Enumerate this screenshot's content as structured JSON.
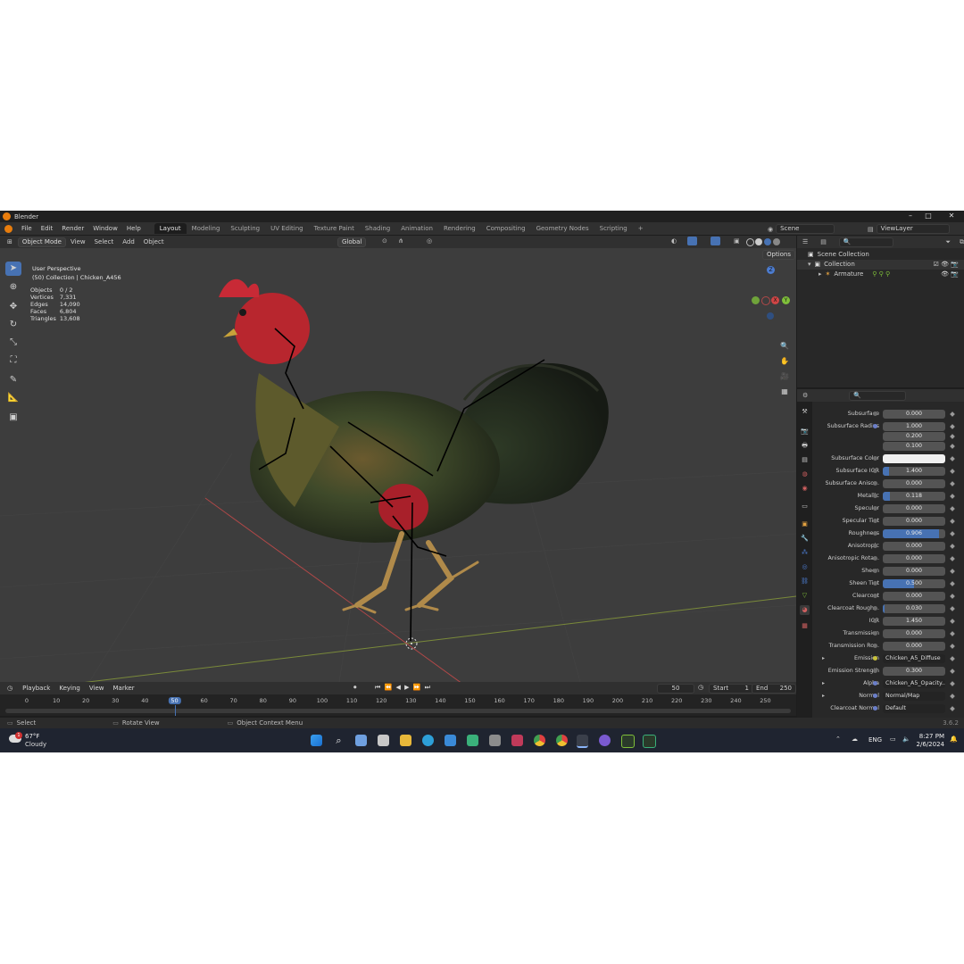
{
  "window": {
    "title": "Blender",
    "min": "–",
    "max": "□",
    "close": "✕"
  },
  "menu": [
    "File",
    "Edit",
    "Render",
    "Window",
    "Help"
  ],
  "workspaces": [
    {
      "label": "Layout",
      "active": true
    },
    {
      "label": "Modeling"
    },
    {
      "label": "Sculpting"
    },
    {
      "label": "UV Editing"
    },
    {
      "label": "Texture Paint"
    },
    {
      "label": "Shading"
    },
    {
      "label": "Animation"
    },
    {
      "label": "Rendering"
    },
    {
      "label": "Compositing"
    },
    {
      "label": "Geometry Nodes"
    },
    {
      "label": "Scripting"
    }
  ],
  "add_workspace": "+",
  "scene": "Scene",
  "view_layer": "ViewLayer",
  "viewport_header": {
    "mode": "Object Mode",
    "menus": [
      "View",
      "Select",
      "Add",
      "Object"
    ],
    "orientation": "Global",
    "options": "Options"
  },
  "overlay": {
    "perspective": "User Perspective",
    "collection": "(50) Collection | Chicken_A456",
    "stats": [
      {
        "label": "Objects",
        "value": "0 / 2"
      },
      {
        "label": "Vertices",
        "value": "7,331"
      },
      {
        "label": "Edges",
        "value": "14,090"
      },
      {
        "label": "Faces",
        "value": "6,804"
      },
      {
        "label": "Triangles",
        "value": "13,608"
      }
    ]
  },
  "gizmo": {
    "z": "Z",
    "y": "Y",
    "x": "X"
  },
  "outliner": {
    "root": "Scene Collection",
    "collection": "Collection",
    "item": "Armature"
  },
  "properties": [
    {
      "label": "Subsurface",
      "value": "0.000",
      "type": "num",
      "fill": 0
    },
    {
      "label": "Subsurface Radius",
      "value": "1.000",
      "type": "num",
      "fill": 0,
      "link": true
    },
    {
      "label": "",
      "value": "0.200",
      "type": "num",
      "fill": 0
    },
    {
      "label": "",
      "value": "0.100",
      "type": "num",
      "fill": 0
    },
    {
      "label": "Subsurface Color",
      "value": "",
      "type": "color",
      "color": "#f0f0f0"
    },
    {
      "label": "Subsurface IOR",
      "value": "1.400",
      "type": "num",
      "fill": 0.1
    },
    {
      "label": "Subsurface Aniso...",
      "value": "0.000",
      "type": "num",
      "fill": 0
    },
    {
      "label": "Metallic",
      "value": "0.118",
      "type": "num",
      "fill": 0.118
    },
    {
      "label": "Specular",
      "value": "0.000",
      "type": "num",
      "fill": 0
    },
    {
      "label": "Specular Tint",
      "value": "0.000",
      "type": "num",
      "fill": 0
    },
    {
      "label": "Roughness",
      "value": "0.906",
      "type": "num",
      "fill": 0.906
    },
    {
      "label": "Anisotropic",
      "value": "0.000",
      "type": "num",
      "fill": 0
    },
    {
      "label": "Anisotropic Rota...",
      "value": "0.000",
      "type": "num",
      "fill": 0
    },
    {
      "label": "Sheen",
      "value": "0.000",
      "type": "num",
      "fill": 0
    },
    {
      "label": "Sheen Tint",
      "value": "0.500",
      "type": "num",
      "fill": 0.5
    },
    {
      "label": "Clearcoat",
      "value": "0.000",
      "type": "num",
      "fill": 0
    },
    {
      "label": "Clearcoat Rough...",
      "value": "0.030",
      "type": "num",
      "fill": 0.03
    },
    {
      "label": "IOR",
      "value": "1.450",
      "type": "num",
      "fill": 0
    },
    {
      "label": "Transmission",
      "value": "0.000",
      "type": "num",
      "fill": 0
    },
    {
      "label": "Transmission Ro...",
      "value": "0.000",
      "type": "num",
      "fill": 0
    },
    {
      "label": "Emission",
      "value": "Chicken_A5_Diffuse",
      "type": "node",
      "dot": "yellow",
      "arrow": true
    },
    {
      "label": "Emission Strength",
      "value": "0.300",
      "type": "num",
      "fill": 0
    },
    {
      "label": "Alpha",
      "value": "Chicken_A5_Opacity....",
      "type": "node",
      "dot": "link",
      "arrow": true
    },
    {
      "label": "Normal",
      "value": "Normal/Map",
      "type": "node",
      "dot": "link",
      "arrow": true
    },
    {
      "label": "Clearcoat Normal",
      "value": "Default",
      "type": "node",
      "dot": "link"
    }
  ],
  "timeline": {
    "menus": [
      "Playback",
      "Keying",
      "View",
      "Marker"
    ],
    "current_frame": "50",
    "start_label": "Start",
    "start": "1",
    "end_label": "End",
    "end": "250",
    "ticks": [
      "0",
      "10",
      "20",
      "30",
      "40",
      "50",
      "60",
      "70",
      "80",
      "90",
      "100",
      "110",
      "120",
      "130",
      "140",
      "150",
      "160",
      "170",
      "180",
      "190",
      "200",
      "210",
      "220",
      "230",
      "240",
      "250"
    ],
    "current_tick": "50"
  },
  "statusbar": {
    "select": "Select",
    "rotate": "Rotate View",
    "context": "Object Context Menu",
    "version": "3.6.2"
  },
  "taskbar": {
    "weather_temp": "67°F",
    "weather_desc": "Cloudy",
    "badge": "1",
    "lang": "ENG",
    "time": "8:27 PM",
    "date": "2/6/2024"
  },
  "colors": {
    "accent": "#4772b3",
    "viewport": "#3d3d3d",
    "blender_orange": "#e87d0d"
  }
}
